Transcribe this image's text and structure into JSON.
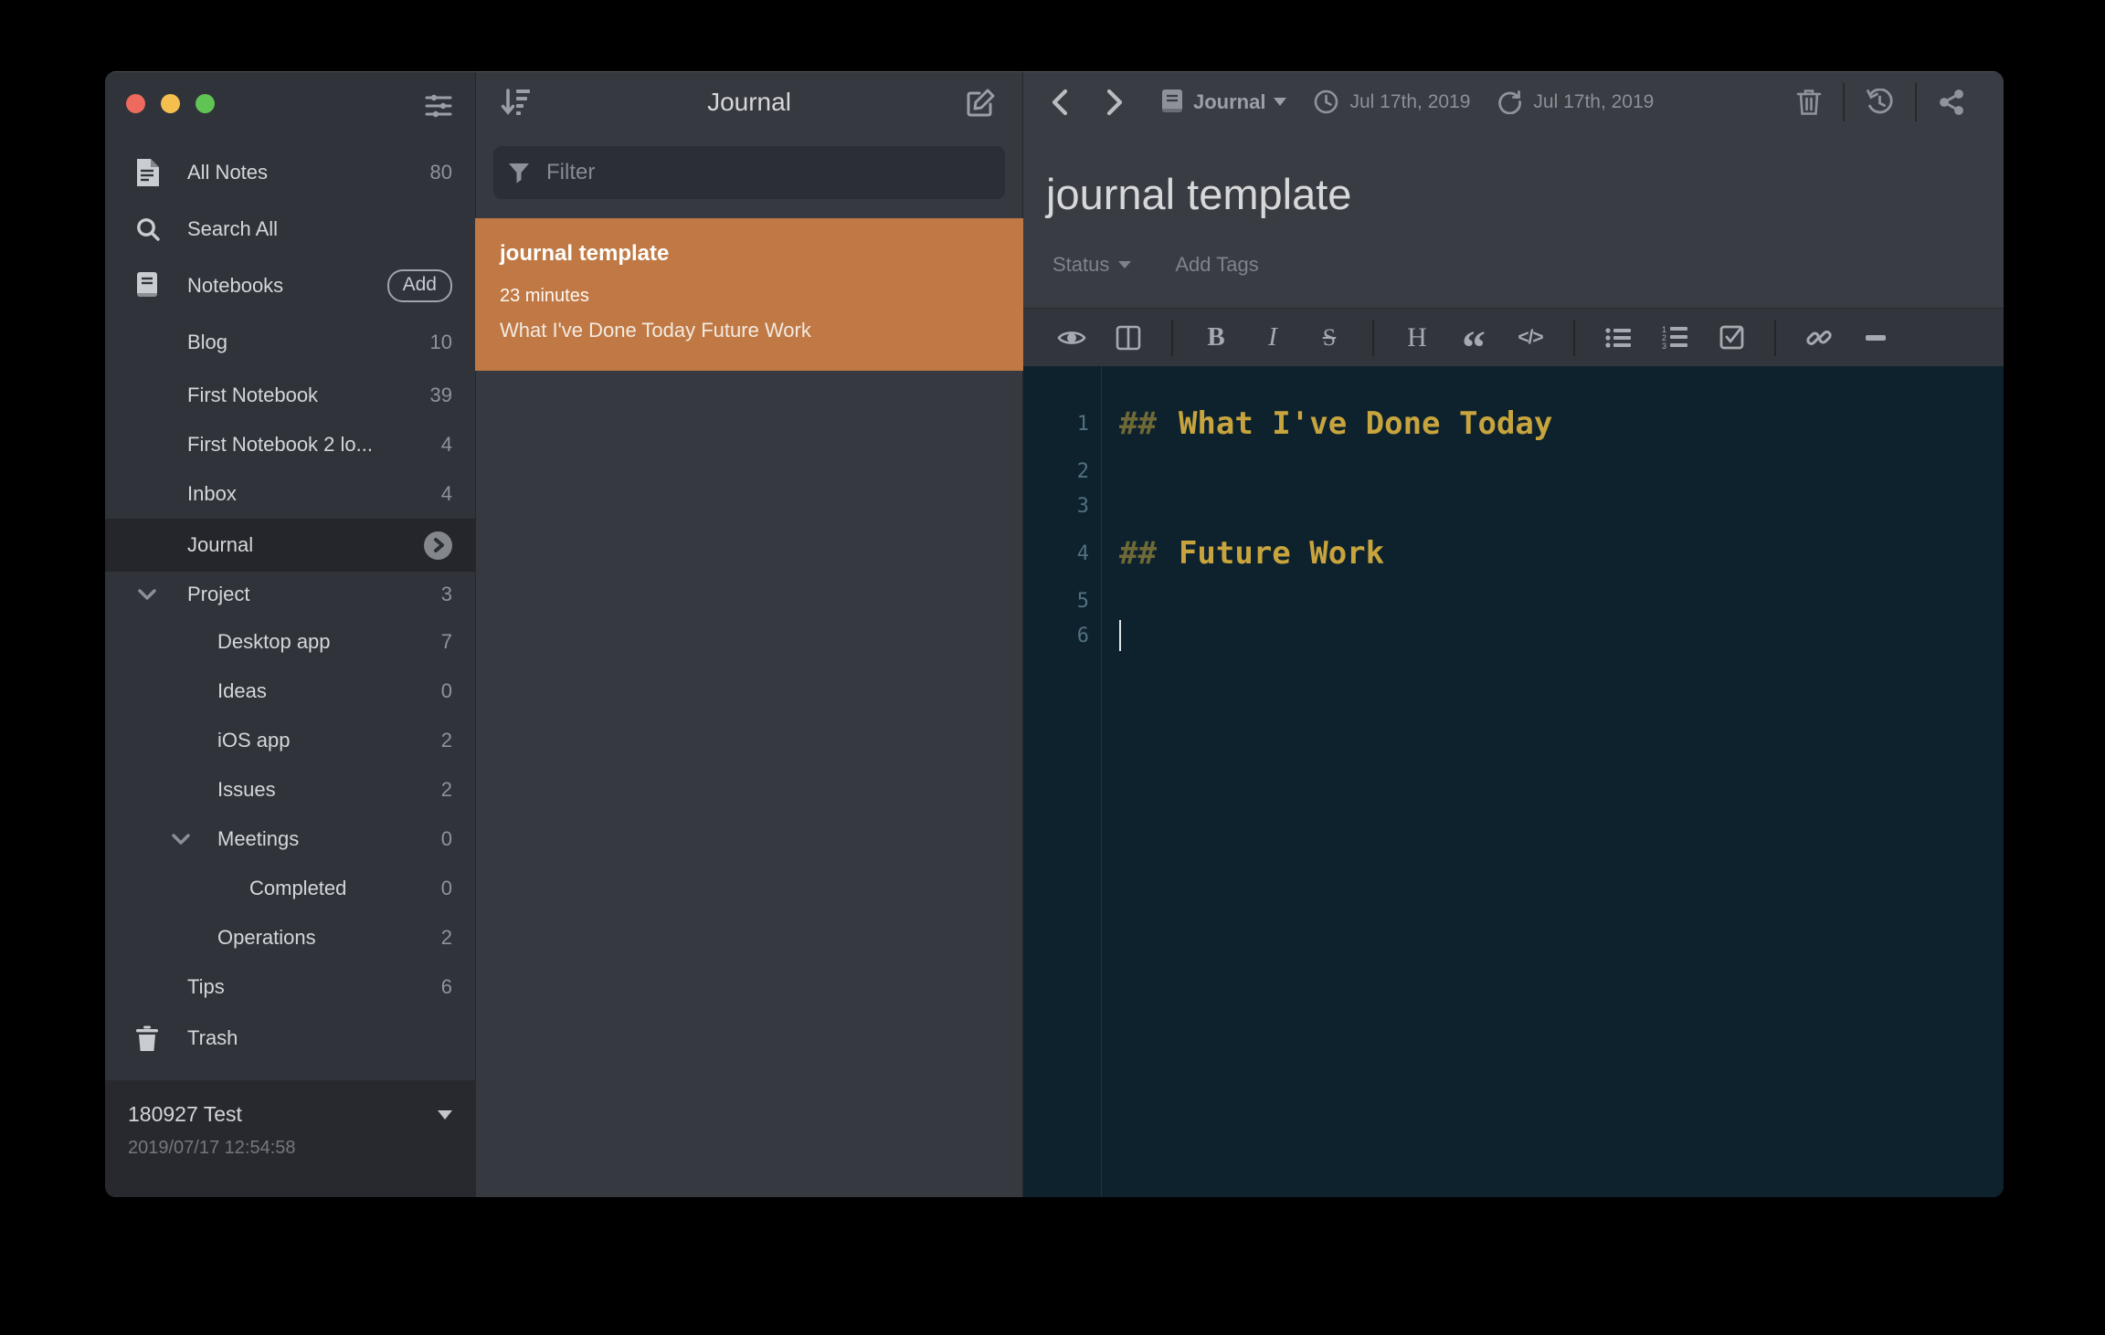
{
  "sidebar": {
    "items": [
      {
        "label": "All Notes",
        "count": "80",
        "icon": "note-icon",
        "indent": 0
      },
      {
        "label": "Search All",
        "count": "",
        "icon": "search-icon",
        "indent": 0
      },
      {
        "label": "Notebooks",
        "count": "",
        "icon": "book-icon",
        "indent": 0,
        "action_label": "Add"
      },
      {
        "label": "Blog",
        "count": "10",
        "indent": 1
      },
      {
        "label": "First Notebook",
        "count": "39",
        "indent": 1
      },
      {
        "label": "First Notebook 2 lo...",
        "count": "4",
        "indent": 1
      },
      {
        "label": "Inbox",
        "count": "4",
        "indent": 1
      },
      {
        "label": "Journal",
        "count": "",
        "indent": 1,
        "selected": true
      },
      {
        "label": "Project",
        "count": "3",
        "indent": 1,
        "expanded": true
      },
      {
        "label": "Desktop app",
        "count": "7",
        "indent": 2
      },
      {
        "label": "Ideas",
        "count": "0",
        "indent": 2
      },
      {
        "label": "iOS app",
        "count": "2",
        "indent": 2
      },
      {
        "label": "Issues",
        "count": "2",
        "indent": 2
      },
      {
        "label": "Meetings",
        "count": "0",
        "indent": 2,
        "expanded": true
      },
      {
        "label": "Completed",
        "count": "0",
        "indent": 3
      },
      {
        "label": "Operations",
        "count": "2",
        "indent": 2
      },
      {
        "label": "Tips",
        "count": "6",
        "indent": 1
      },
      {
        "label": "Trash",
        "count": "",
        "icon": "trash-icon",
        "indent": 0
      }
    ],
    "footer": {
      "account": "180927 Test",
      "synced_at": "2019/07/17 12:54:58"
    }
  },
  "notelist": {
    "title": "Journal",
    "filter_placeholder": "Filter",
    "notes": [
      {
        "title": "journal template",
        "updated": "23 minutes",
        "preview": "What I've Done Today Future Work",
        "selected": true
      }
    ]
  },
  "editor": {
    "topbar": {
      "notebook": "Journal",
      "created_date": "Jul 17th, 2019",
      "updated_date": "Jul 17th, 2019"
    },
    "note_title": "journal template",
    "status_label": "Status",
    "tags_placeholder": "Add Tags",
    "toolbar_glyphs": {
      "bold": "B",
      "italic": "I",
      "strike": "S",
      "heading": "H",
      "quote": "“",
      "code": "</>"
    },
    "lines": [
      {
        "num": "1",
        "type": "heading",
        "prefix": "##",
        "text": "What I've Done Today"
      },
      {
        "num": "2",
        "type": "plain",
        "text": ""
      },
      {
        "num": "3",
        "type": "plain",
        "text": ""
      },
      {
        "num": "4",
        "type": "heading",
        "prefix": "##",
        "text": "Future Work"
      },
      {
        "num": "5",
        "type": "plain",
        "text": ""
      },
      {
        "num": "6",
        "type": "plain",
        "text": "",
        "cursor": true
      }
    ]
  },
  "colors": {
    "accent_orange": "#c07944",
    "editor_bg": "#0e222d",
    "heading_gold": "#c7a43d",
    "heading_prefix": "#6e6937",
    "sidebar_bg": "#30343a",
    "panel_bg": "#36393f",
    "header_bg": "#393c42",
    "selected_row": "#24262b",
    "traffic_red": "#ee6a5f",
    "traffic_yellow": "#f5bf4f",
    "traffic_green": "#5fc454"
  },
  "icons": [
    "sliders-icon",
    "note-icon",
    "search-icon",
    "book-icon",
    "trash-icon",
    "chevron-down-icon",
    "chevron-right-icon",
    "sort-descending-icon",
    "compose-icon",
    "funnel-icon",
    "back-icon",
    "forward-icon",
    "notebook-icon",
    "caret-down-icon",
    "clock-icon",
    "updated-icon",
    "trash-outline-icon",
    "history-icon",
    "share-icon",
    "eye-icon",
    "columns-icon",
    "bullet-list-icon",
    "ordered-list-icon",
    "checkbox-icon",
    "link-icon",
    "hr-icon"
  ]
}
